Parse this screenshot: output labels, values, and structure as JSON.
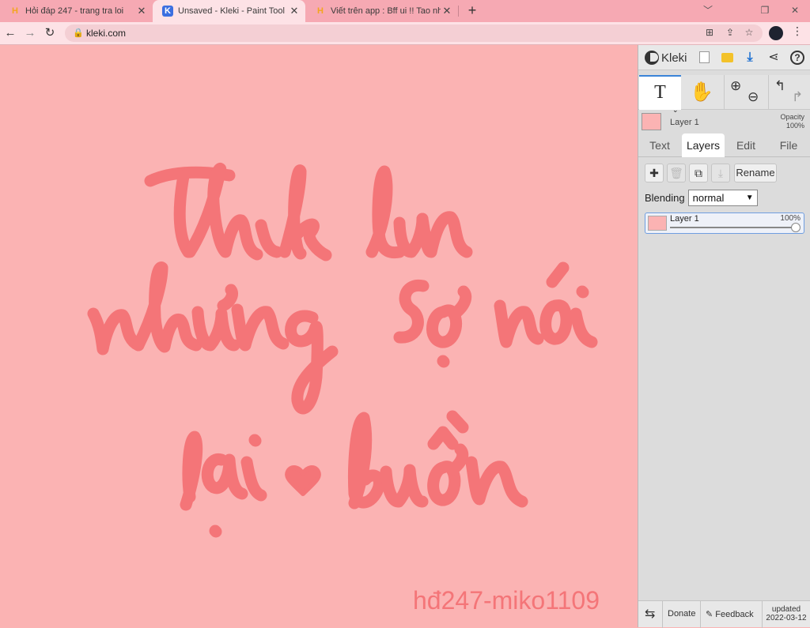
{
  "browser": {
    "tabs": [
      {
        "title": "Hỏi đáp 247 - trang tra loi",
        "favicon": "hoidap-icon",
        "active": false
      },
      {
        "title": "Unsaved - Kleki - Paint Tool",
        "favicon": "kleki-icon",
        "active": true
      },
      {
        "title": "Viết trên app : Bff ui !! Tao nhớ m",
        "favicon": "hoidap-icon",
        "active": false
      }
    ],
    "new_tab": "+",
    "url": "kleki.com",
    "window_controls": {
      "minimize": "﹀",
      "restore": "❐",
      "close": "✕"
    }
  },
  "canvas": {
    "background": "#fbb3b3",
    "ink_color": "#f47578",
    "handwriting_lines": [
      "Thik lun",
      "nhưng sợ nói",
      "lại ♥ buồn"
    ],
    "watermark": "hđ247-miko1109"
  },
  "kleki": {
    "logo": "Kleki",
    "topbar_icons": [
      "new-image-icon",
      "open-folder-icon",
      "download-icon",
      "share-icon",
      "help-icon"
    ],
    "tools": {
      "text_tool": "T",
      "hand_tool": "✋",
      "zoom_in": "⊕",
      "zoom_out": "⊖",
      "undo": "↰",
      "redo": "↱"
    },
    "active_layer": {
      "name": "Layer 1",
      "opacity_label": "Opacity",
      "opacity_value": "100%"
    },
    "tabs": [
      "Text",
      "Layers",
      "Edit",
      "File"
    ],
    "active_tab": "Layers",
    "layer_buttons": {
      "add": "✚",
      "delete": "🗑",
      "duplicate": "⧉",
      "merge": "⤓",
      "rename": "Rename"
    },
    "blending": {
      "label": "Blending",
      "value": "normal"
    },
    "layers": [
      {
        "name": "Layer 1",
        "opacity": "100%",
        "opacity_fraction": 1.0
      }
    ],
    "bottom": {
      "swap": "⇆",
      "donate": "Donate",
      "feedback": "Feedback",
      "updated_label": "updated",
      "updated_date": "2022-03-12"
    }
  }
}
